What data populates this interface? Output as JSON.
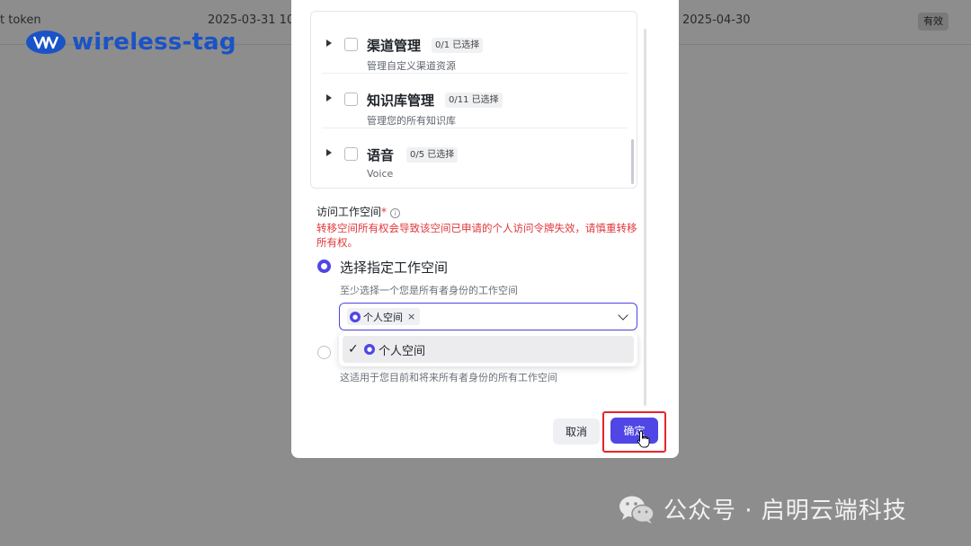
{
  "background_row": {
    "name_partial": "t token",
    "created": "2025-03-31 10:",
    "expires": "2025-04-30",
    "status": "有效"
  },
  "logo": {
    "text": "wireless-tag",
    "color": "#1a53c6"
  },
  "modal": {
    "permissions": [
      {
        "title": "渠道管理",
        "count": "0/1 已选择",
        "desc": "管理自定义渠道资源"
      },
      {
        "title": "知识库管理",
        "count": "0/11 已选择",
        "desc": "管理您的所有知识库"
      },
      {
        "title": "语音",
        "count": "0/5 已选择",
        "desc": "Voice"
      }
    ],
    "workspace_label": "访问工作空间",
    "required_mark": "*",
    "info_icon": "i",
    "warning": "转移空间所有权会导致该空间已申请的个人访问令牌失效，请慎重转移所有权。",
    "option_specific": {
      "title": "选择指定工作空间",
      "desc": "至少选择一个您是所有者身份的工作空间",
      "selected_tag": "个人空间",
      "tag_close": "×"
    },
    "dropdown_option": {
      "check": "✓",
      "label": "个人空间"
    },
    "option_all": {
      "desc": "这适用于您目前和将来所有者身份的所有工作空间"
    },
    "cancel_label": "取消",
    "ok_label": "确定",
    "accent_color": "#4f46e5"
  },
  "watermark": {
    "text": "公众号 · 启明云端科技"
  }
}
